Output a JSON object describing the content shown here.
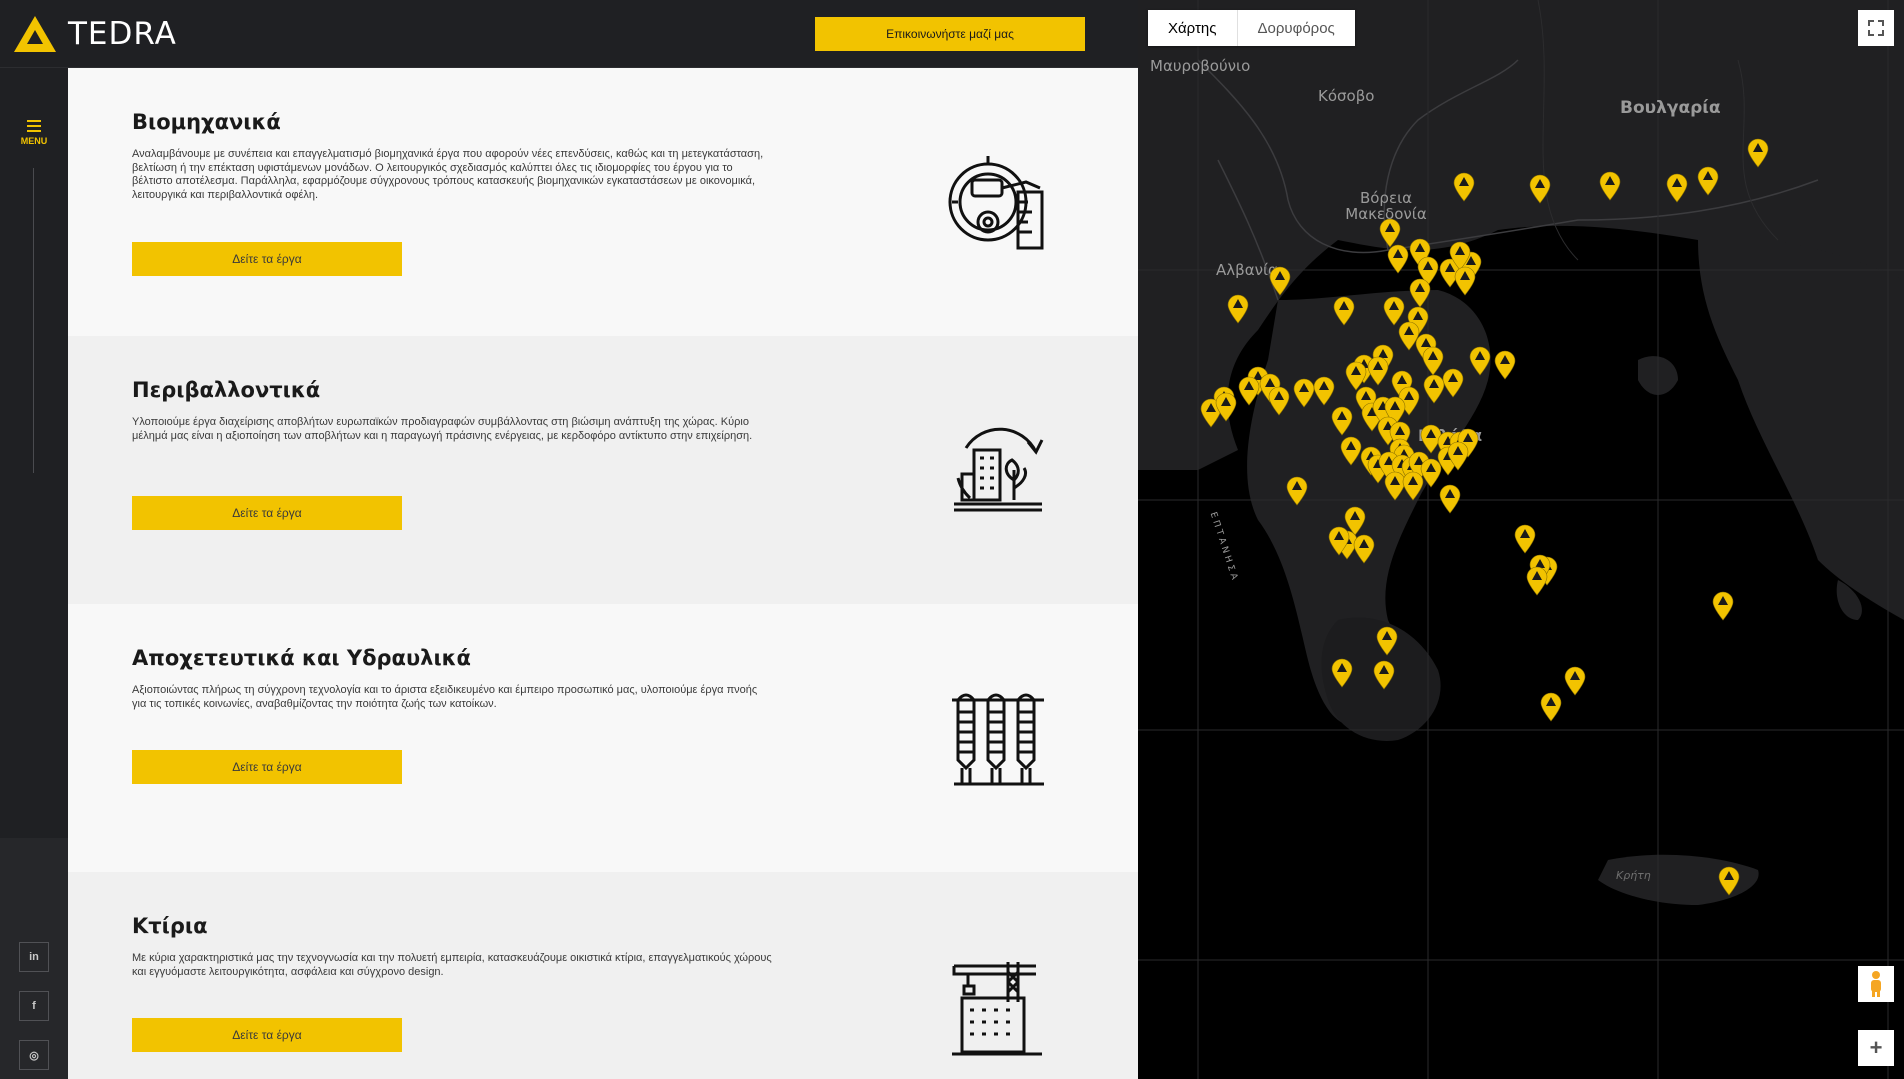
{
  "header": {
    "brand": "TEDRA",
    "contact_label": "Επικοινωνήστε μαζί μας"
  },
  "sidebar": {
    "menu_label": "MENU",
    "social": [
      {
        "name": "linkedin-icon",
        "glyph": "in"
      },
      {
        "name": "facebook-icon",
        "glyph": "f"
      },
      {
        "name": "instagram-icon",
        "glyph": "◎"
      }
    ]
  },
  "sections": [
    {
      "title": "Βιομηχανικά",
      "description": "Αναλαμβάνουμε με συνέπεια και επαγγελματισμό βιομηχανικά έργα που αφορούν νέες επενδύσεις, καθώς και τη μετεγκατάσταση, βελτίωση ή την επέκταση υφιστάμενων μονάδων. Ο λειτουργικός σχεδιασμός καλύπτει όλες τις ιδιομορφίες του έργου για το βέλτιστο αποτέλεσμα. Παράλληλα, εφαρμόζουμε σύγχρονους τρόπους κατασκευής βιομηχανικών εγκαταστάσεων με οικονομικά, λειτουργικά και περιβαλλοντικά οφέλη.",
      "button": "Δείτε τα έργα",
      "icon": "industrial-gear-icon"
    },
    {
      "title": "Περιβαλλοντικά",
      "description": "Υλοποιούμε έργα διαχείρισης αποβλήτων ευρωπαϊκών προδιαγραφών συμβάλλοντας στη βιώσιμη ανάπτυξη της χώρας. Κύριο μέλημά μας είναι η αξιοποίηση των αποβλήτων και η παραγωγή πράσινης ενέργειας, με κερδοφόρο αντίκτυπο στην επιχείρηση.",
      "button": "Δείτε τα έργα",
      "icon": "environmental-recycle-icon"
    },
    {
      "title": "Αποχετευτικά και Υδραυλικά",
      "description": "Αξιοποιώντας πλήρως τη σύγχρονη τεχνολογία και το άριστα εξειδικευμένο και έμπειρο προσωπικό μας, υλοποιούμε έργα πνοής για τις τοπικές κοινωνίες, αναβαθμίζοντας την ποιότητα ζωής των κατοίκων.",
      "button": "Δείτε τα έργα",
      "icon": "silos-icon"
    },
    {
      "title": "Κτίρια",
      "description": "Με κύρια χαρακτηριστικά μας την τεχνογνωσία και την πολυετή εμπειρία, κατασκευάζουμε οικιστικά κτίρια, επαγγελματικούς χώρους και εγγυόμαστε λειτουργικότητα, ασφάλεια και σύγχρονο design.",
      "button": "Δείτε τα έργα",
      "icon": "building-crane-icon"
    }
  ],
  "map": {
    "tab_map": "Χάρτης",
    "tab_satellite": "Δορυφόρος",
    "labels": {
      "montenegro": "Μαυροβούνιο",
      "kosovo": "Κόσοβο",
      "bulgaria": "Βουλγαρία",
      "north_macedonia": "Βόρεια Μακεδονία",
      "albania": "Αλβανία",
      "greece": "Ελλάδα",
      "ionian": "ΕΠΤΑΝΗΣΑ",
      "crete": "Κρήτη"
    }
  },
  "colors": {
    "accent": "#f2c300",
    "dark": "#1f2023"
  }
}
